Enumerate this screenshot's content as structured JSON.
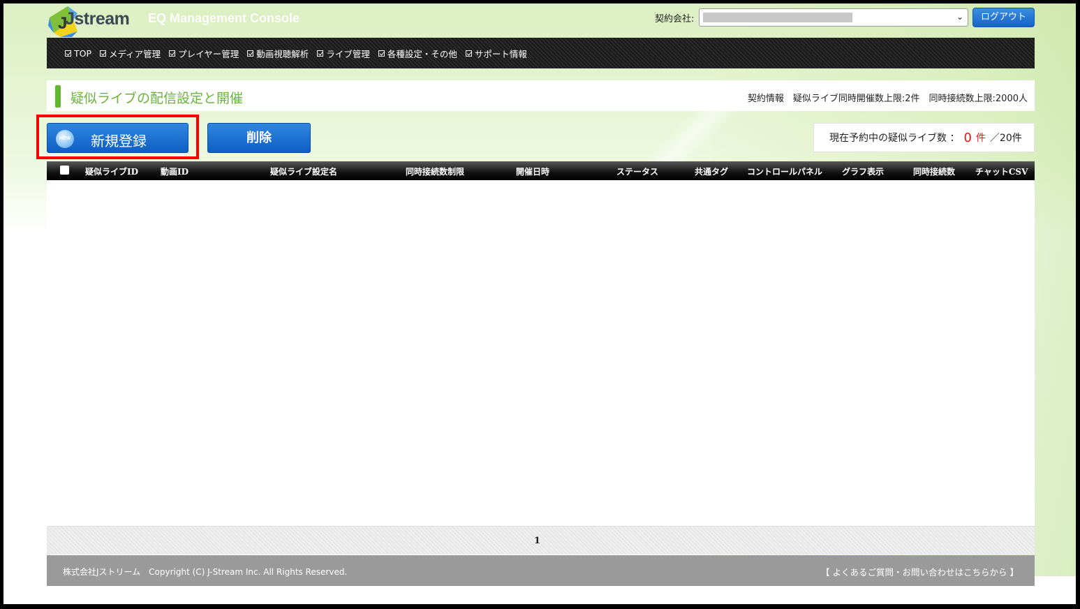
{
  "header": {
    "logo_text": "Jstream",
    "console_title": "EQ Management Console",
    "contract_label": "契約会社:",
    "logout_label": "ログアウト"
  },
  "nav": {
    "items": [
      {
        "label": "TOP"
      },
      {
        "label": "メディア管理"
      },
      {
        "label": "プレイヤー管理"
      },
      {
        "label": "動画視聴解析"
      },
      {
        "label": "ライブ管理"
      },
      {
        "label": "各種設定・その他"
      },
      {
        "label": "サポート情報"
      }
    ]
  },
  "page": {
    "title": "疑似ライブの配信設定と開催",
    "contract_info": "契約情報　疑似ライブ同時開催数上限:2件　同時接続数上限:2000人"
  },
  "actions": {
    "new_icon_text": "NEW",
    "new_label": "新規登録",
    "delete_label": "削除"
  },
  "reservation": {
    "label": "現在予約中の疑似ライブ数 ：",
    "count": "0",
    "unit": "件",
    "limit": "／20件"
  },
  "table": {
    "columns": [
      {
        "label": "疑似ライブID"
      },
      {
        "label": "動画ID"
      },
      {
        "label": "疑似ライブ設定名"
      },
      {
        "label": "同時接続数制限"
      },
      {
        "label": "開催日時"
      },
      {
        "label": "ステータス"
      },
      {
        "label": "共通タグ"
      },
      {
        "label": "コントロールパネル"
      },
      {
        "label": "グラフ表示"
      },
      {
        "label": "同時接続数"
      },
      {
        "label": "チャットCSV"
      }
    ],
    "rows": []
  },
  "pagination": {
    "current_page": "1"
  },
  "footer": {
    "copyright": "株式会社Jストリーム　Copyright (C) J-Stream Inc. All Rights Reserved.",
    "contact_link": "【 よくあるご質問・お問い合わせはこちらから 】"
  }
}
